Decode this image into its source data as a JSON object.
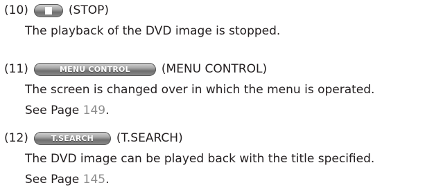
{
  "items": [
    {
      "number": "(10)",
      "button_label": "",
      "button_icon": "stop-square-icon",
      "name": "(STOP)",
      "description": "The playback of the DVD image is stopped."
    },
    {
      "number": "(11)",
      "button_label": "MENU CONTROL",
      "name": "(MENU CONTROL)",
      "description": "The screen is changed over in which the menu is operated.",
      "see_prefix": "See Page ",
      "page": "149",
      "see_suffix": "."
    },
    {
      "number": "(12)",
      "button_label": "T.SEARCH",
      "name": "(T.SEARCH)",
      "description": "The DVD image can be played back with the title specified.",
      "see_prefix": "See Page ",
      "page": "145",
      "see_suffix": "."
    }
  ],
  "colors": {
    "text": "#231f20",
    "page_link": "#8c8c8c",
    "button_top": "#d8d8d8",
    "button_bottom": "#6e6e6e"
  }
}
